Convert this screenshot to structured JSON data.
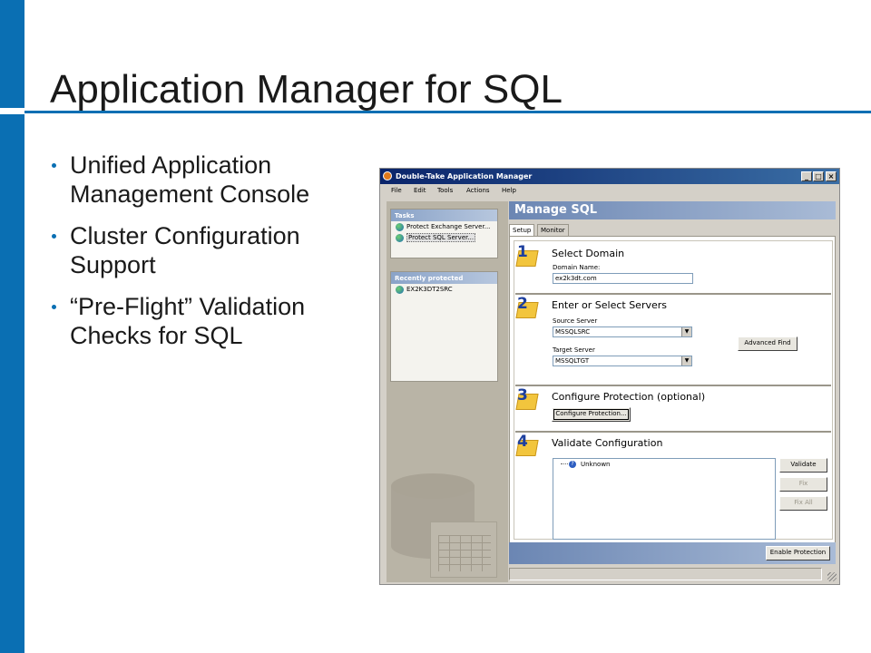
{
  "slide": {
    "title": "Application Manager for SQL",
    "bullets": [
      "Unified Application Management Console",
      "Cluster Configuration Support",
      "“Pre-Flight” Validation Checks for SQL"
    ]
  },
  "window": {
    "title": "Double-Take Application Manager",
    "controls": {
      "minimize": "_",
      "maximize": "□",
      "close": "×"
    },
    "menu": [
      "File",
      "Edit",
      "Tools",
      "Actions",
      "Help"
    ]
  },
  "sidebar": {
    "tasks": {
      "header": "Tasks",
      "items": [
        "Protect Exchange Server...",
        "Protect SQL Server..."
      ]
    },
    "recent": {
      "header": "Recently protected",
      "items": [
        "EX2K3DT2SRC"
      ]
    }
  },
  "main": {
    "header": "Manage SQL",
    "tabs": [
      "Setup",
      "Monitor"
    ],
    "steps": {
      "s1": {
        "num": "1",
        "title": "Select Domain",
        "domain_label": "Domain Name:",
        "domain_value": "ex2k3dt.com"
      },
      "s2": {
        "num": "2",
        "title": "Enter or Select Servers",
        "source_label": "Source Server",
        "source_value": "MSSQLSRC",
        "target_label": "Target Server",
        "target_value": "MSSQLTGT",
        "advanced_find": "Advanced Find"
      },
      "s3": {
        "num": "3",
        "title": "Configure Protection (optional)",
        "button": "Configure Protection..."
      },
      "s4": {
        "num": "4",
        "title": "Validate Configuration",
        "result": "Unknown",
        "validate": "Validate",
        "fix": "Fix",
        "fix_all": "Fix All"
      }
    },
    "enable_protection": "Enable Protection"
  }
}
